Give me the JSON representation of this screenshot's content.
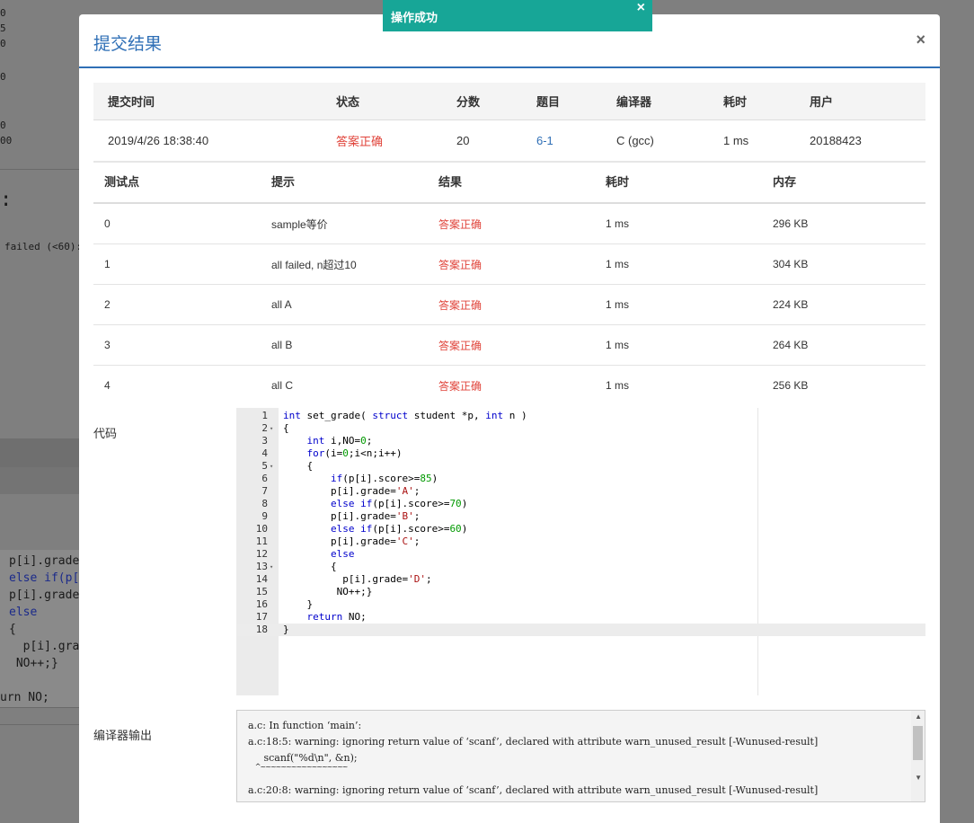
{
  "toast": {
    "text": "操作成功",
    "close": "×"
  },
  "modal": {
    "title": "提交结果",
    "close": "×"
  },
  "background": {
    "numbers": [
      "0",
      "5",
      "0",
      "0",
      "0",
      "00"
    ],
    "colon": ":",
    "failed_text": "failed (<60):",
    "code_lines": [
      "p[i].grade",
      "else if(p[",
      "p[i].grade",
      "else",
      "{",
      "  p[i].grad",
      " NO++;}",
      "urn NO;"
    ]
  },
  "submission": {
    "headers": [
      "提交时间",
      "状态",
      "分数",
      "题目",
      "编译器",
      "耗时",
      "用户"
    ],
    "row": {
      "time": "2019/4/26 18:38:40",
      "status": "答案正确",
      "score": "20",
      "problem": "6-1",
      "compiler": "C (gcc)",
      "elapsed": "1 ms",
      "user": "20188423"
    }
  },
  "testcases": {
    "headers": [
      "测试点",
      "提示",
      "结果",
      "耗时",
      "内存"
    ],
    "rows": [
      {
        "id": "0",
        "hint": "sample等价",
        "result": "答案正确",
        "time": "1 ms",
        "mem": "296 KB"
      },
      {
        "id": "1",
        "hint": "all failed, n超过10",
        "result": "答案正确",
        "time": "1 ms",
        "mem": "304 KB"
      },
      {
        "id": "2",
        "hint": "all A",
        "result": "答案正确",
        "time": "1 ms",
        "mem": "224 KB"
      },
      {
        "id": "3",
        "hint": "all B",
        "result": "答案正确",
        "time": "1 ms",
        "mem": "264 KB"
      },
      {
        "id": "4",
        "hint": "all C",
        "result": "答案正确",
        "time": "1 ms",
        "mem": "256 KB"
      }
    ]
  },
  "code": {
    "label": "代码",
    "line_numbers": [
      "1",
      "2",
      "3",
      "4",
      "5",
      "6",
      "7",
      "8",
      "9",
      "10",
      "11",
      "12",
      "13",
      "14",
      "15",
      "16",
      "17",
      "18"
    ],
    "fold_marker": "▾"
  },
  "compiler_output": {
    "label": "编译器输出",
    "lines": [
      "a.c: In function ‘main’:",
      "a.c:18:5: warning: ignoring return value of ‘scanf’, declared with attribute warn_unused_result [-Wunused-result]",
      "     scanf(\"%d\\n\", &n);",
      "     ^~~~~~~~~~~~~~~~~~",
      "a.c:20:8: warning: ignoring return value of ‘scanf’, declared with attribute warn_unused_result [-Wunused-result]"
    ],
    "scroll_up": "▲",
    "scroll_down": "▼"
  }
}
